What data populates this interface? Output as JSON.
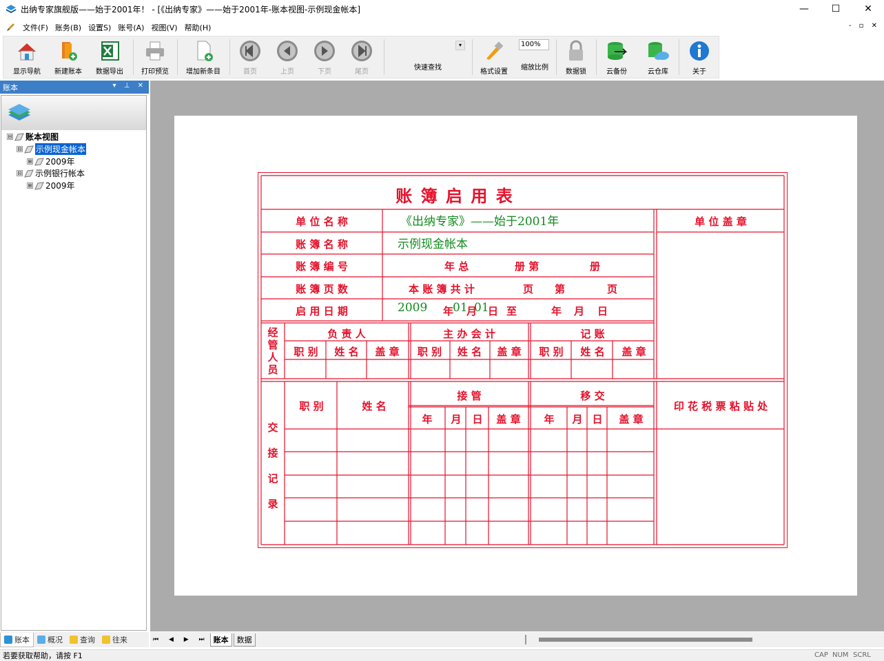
{
  "window": {
    "title": "出纳专家旗舰版——始于2001年！ - [《出纳专家》——始于2001年-账本视图-示例现金帐本]",
    "minimize": "—",
    "maximize": "☐",
    "close": "✕"
  },
  "menu": {
    "items": [
      "文件(F)",
      "账务(B)",
      "设置S)",
      "账号(A)",
      "视图(V)",
      "帮助(H)"
    ],
    "mdi_controls": "- ▫ ✕"
  },
  "toolbar": {
    "buttons": [
      {
        "label": "显示导航",
        "icon": "house-icon"
      },
      {
        "label": "新建账本",
        "icon": "new-book-icon"
      },
      {
        "label": "数据导出",
        "icon": "excel-icon"
      },
      {
        "label": "打印预览",
        "icon": "printer-icon"
      },
      {
        "label": "增加新条目",
        "icon": "add-document-icon"
      },
      {
        "label": "首页",
        "icon": "first-page-icon"
      },
      {
        "label": "上页",
        "icon": "prev-page-icon"
      },
      {
        "label": "下页",
        "icon": "next-page-icon"
      },
      {
        "label": "尾页",
        "icon": "last-page-icon"
      },
      {
        "label": "快速查找",
        "icon": "search-dropdown"
      },
      {
        "label": "格式设置",
        "icon": "format-brush-icon"
      },
      {
        "label": "缩放比例",
        "icon": "zoom-select"
      },
      {
        "label": "数据锁",
        "icon": "lock-icon"
      },
      {
        "label": "云备份",
        "icon": "cloud-backup-icon"
      },
      {
        "label": "云仓库",
        "icon": "cloud-store-icon"
      },
      {
        "label": "关于",
        "icon": "info-icon"
      }
    ],
    "zoom_value": "100%"
  },
  "left_panel": {
    "title": "账本",
    "controls": "▾ ⊥ ✕",
    "tree": [
      {
        "label": "账本视图",
        "level": 0,
        "expander": "⊟",
        "bold": true
      },
      {
        "label": "示例现金帐本",
        "level": 1,
        "expander": "⊟",
        "selected": true
      },
      {
        "label": "2009年",
        "level": 2,
        "expander": "⊞"
      },
      {
        "label": "示例银行帐本",
        "level": 1,
        "expander": "⊟"
      },
      {
        "label": "2009年",
        "level": 2,
        "expander": "⊞"
      }
    ],
    "tabs": [
      "账本",
      "概况",
      "查询",
      "往来"
    ]
  },
  "ledger_form": {
    "title": "账 簿 启 用 表",
    "rows": {
      "unit_name_label": "单 位 名 称",
      "unit_name_value": "《出纳专家》——始于2001年",
      "book_name_label": "账 簿 名 称",
      "book_name_value": "示例现金帐本",
      "book_no_label": "账 簿 编 号",
      "book_no_text": [
        "年 总",
        "册 第",
        "册"
      ],
      "pages_label": "账 簿 页 数",
      "pages_text": [
        "本 账 簿 共 计",
        "页",
        "第",
        "页"
      ],
      "start_date_label": "启 用 日 期",
      "start_year": "2009",
      "start_month": "01",
      "start_day": "01",
      "start_date_text": [
        "年",
        "月",
        "日",
        "至",
        "年",
        "月",
        "日"
      ]
    },
    "seal_label": "单 位 盖 章",
    "staff": {
      "side": "经管人员",
      "groups": [
        "负 责 人",
        "主 办 会 计",
        "记     账"
      ],
      "sub": [
        "职 别",
        "姓 名",
        "盖 章"
      ]
    },
    "handover": {
      "side": "交接记录",
      "left_heads": [
        "职 别",
        "姓   名"
      ],
      "groups": [
        "接     管",
        "移     交"
      ],
      "sub": [
        "年",
        "月",
        "日",
        "盖 章"
      ],
      "stamp_label": "印 花 税 票 粘 贴 处"
    },
    "colors": {
      "red": "#e5122b",
      "green": "#128a1e"
    }
  },
  "bottom": {
    "nav": "⏮ ◀ ▶ ⏭",
    "sheet_tabs": [
      "账本",
      "数据"
    ]
  },
  "status": {
    "help": "若要获取帮助，请按 F1",
    "indicators": [
      "CAP",
      "NUM",
      "SCRL"
    ]
  }
}
